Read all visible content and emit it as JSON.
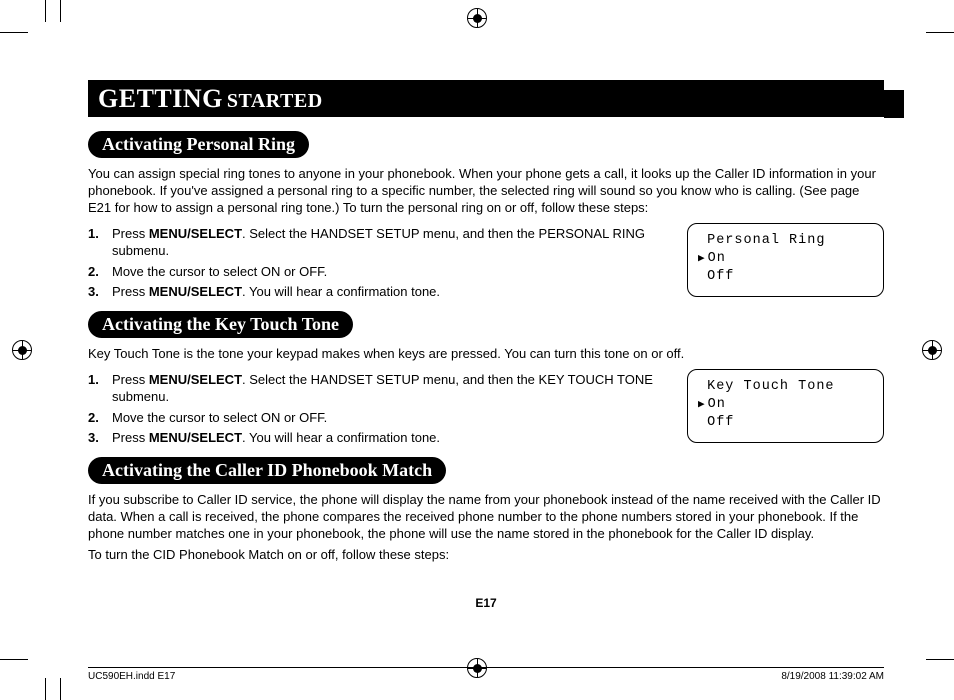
{
  "title": {
    "part1": "GETTING",
    "part2": "STARTED"
  },
  "sections": [
    {
      "heading": "Activating Personal Ring",
      "intro": "You can assign special ring tones to anyone in your phonebook. When your phone gets a call, it looks up the Caller ID information in your phonebook. If you've assigned a personal ring to a specific number, the selected ring will sound so you know who is calling. (See page E21 for how to assign a personal ring tone.) To turn the personal ring on or off, follow these steps:",
      "steps": [
        {
          "pre": "Press ",
          "bold": "MENU/SELECT",
          "post": ". Select the HANDSET SETUP menu, and then the PERSONAL RING submenu."
        },
        {
          "pre": "",
          "bold": "",
          "post": "Move the cursor to select ON or OFF."
        },
        {
          "pre": "Press ",
          "bold": "MENU/SELECT",
          "post": ". You will hear a confirmation tone."
        }
      ],
      "lcd": {
        "title": "Personal Ring",
        "opt1": "On",
        "opt2": "Off"
      }
    },
    {
      "heading": "Activating the Key Touch Tone",
      "intro": "Key Touch Tone is the tone your keypad makes when keys are pressed. You can turn this tone on or off.",
      "steps": [
        {
          "pre": "Press ",
          "bold": "MENU/SELECT",
          "post": ". Select the HANDSET SETUP menu, and then the KEY TOUCH TONE submenu."
        },
        {
          "pre": "",
          "bold": "",
          "post": "Move the cursor to select ON or OFF."
        },
        {
          "pre": "Press ",
          "bold": "MENU/SELECT",
          "post": ". You will hear a confirmation tone."
        }
      ],
      "lcd": {
        "title": "Key Touch Tone",
        "opt1": "On",
        "opt2": "Off"
      }
    },
    {
      "heading": "Activating the Caller ID Phonebook Match",
      "intro": "If you subscribe to Caller ID service, the phone will display the name from your phonebook instead of the name received with the Caller ID data. When a call is received, the phone compares the received phone number to the phone numbers stored in your phonebook. If the phone number matches one in your phonebook, the phone will use the name stored in the phonebook for the Caller ID display.",
      "intro2": "To turn the CID Phonebook Match on or off, follow these steps:"
    }
  ],
  "page_number": "E17",
  "footer": {
    "left": "UC590EH.indd   E17",
    "right": "8/19/2008   11:39:02 AM"
  }
}
